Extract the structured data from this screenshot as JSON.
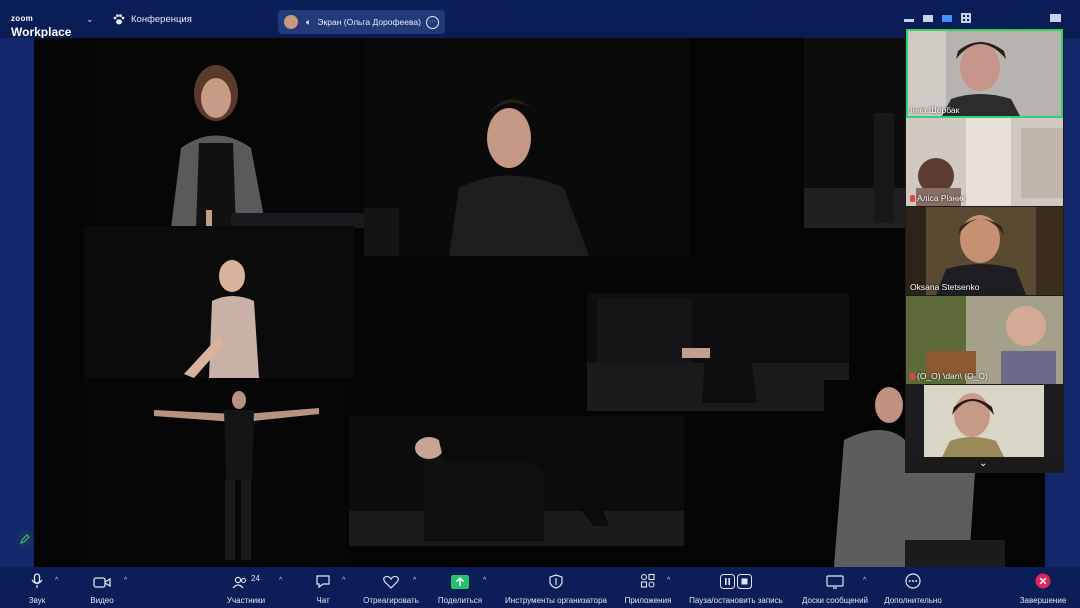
{
  "app": {
    "logo_line1": "zoom",
    "logo_line2": "Workplace",
    "meeting_label": "Конференция",
    "share_label": "Экран (Ольга Дорофеева)"
  },
  "participants": [
    {
      "name": "Інна Щербак",
      "muted": false
    },
    {
      "name": "Аліса Різник",
      "muted": true
    },
    {
      "name": "Oksana Stetsenko",
      "muted": false
    },
    {
      "name": "(O_O) \\dan\\ (O_O)",
      "muted": true
    },
    {
      "name": "",
      "muted": false
    }
  ],
  "toolbar": {
    "audio": "Звук",
    "video": "Видео",
    "participants": "Участники",
    "participants_count": "24",
    "chat": "Чат",
    "react": "Отреагировать",
    "share": "Поделиться",
    "host_tools": "Инструменты организатора",
    "apps": "Приложения",
    "record": "Пауза/остановить запись",
    "whiteboards": "Доски сообщений",
    "more": "Дополнительно",
    "end": "Завершение"
  },
  "colors": {
    "bar_bg": "#0b1e58",
    "accent": "#4a8cff",
    "share_green": "#22c36a",
    "end_red": "#e0245e"
  }
}
